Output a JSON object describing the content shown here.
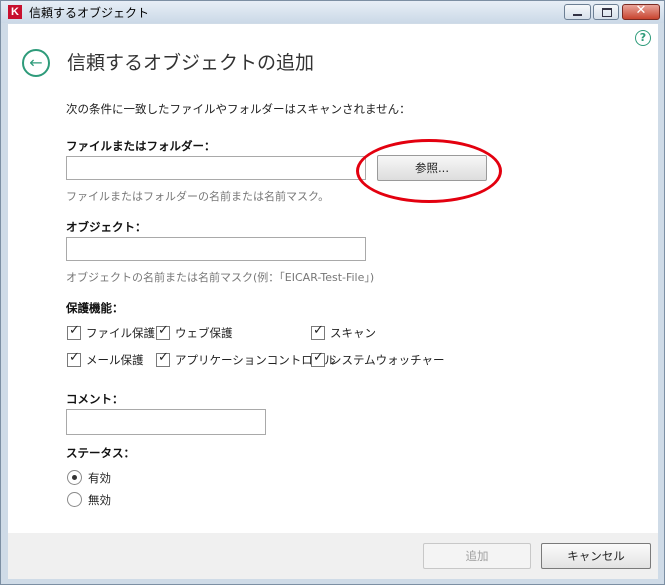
{
  "window": {
    "app_logo": "K",
    "title": "信頼するオブジェクト",
    "close_glyph": "✕"
  },
  "icons": {
    "help": "?",
    "back": "←",
    "check": "✓"
  },
  "header": {
    "title": "信頼するオブジェクトの追加"
  },
  "intro": "次の条件に一致したファイルやフォルダーはスキャンされません：",
  "file_folder": {
    "label": "ファイルまたはフォルダー：",
    "value": "",
    "browse_label": "参照...",
    "hint": "ファイルまたはフォルダーの名前または名前マスク。"
  },
  "object": {
    "label": "オブジェクト：",
    "value": "",
    "hint": "オブジェクトの名前または名前マスク(例：「EICAR-Test-File」)"
  },
  "protection": {
    "label": "保護機能：",
    "items": [
      {
        "label": "ファイル保護",
        "checked": true
      },
      {
        "label": "ウェブ保護",
        "checked": true
      },
      {
        "label": "スキャン",
        "checked": true
      },
      {
        "label": "メール保護",
        "checked": true
      },
      {
        "label": "アプリケーションコントロール",
        "checked": true
      },
      {
        "label": "システムウォッチャー",
        "checked": true
      }
    ]
  },
  "comment": {
    "label": "コメント：",
    "value": ""
  },
  "status": {
    "label": "ステータス：",
    "options": [
      {
        "label": "有効",
        "selected": true
      },
      {
        "label": "無効",
        "selected": false
      }
    ]
  },
  "footer": {
    "add_label": "追加",
    "cancel_label": "キャンセル"
  },
  "colors": {
    "accent": "#2e9b7a",
    "highlight": "#e3000f",
    "brand": "#c8102e"
  }
}
